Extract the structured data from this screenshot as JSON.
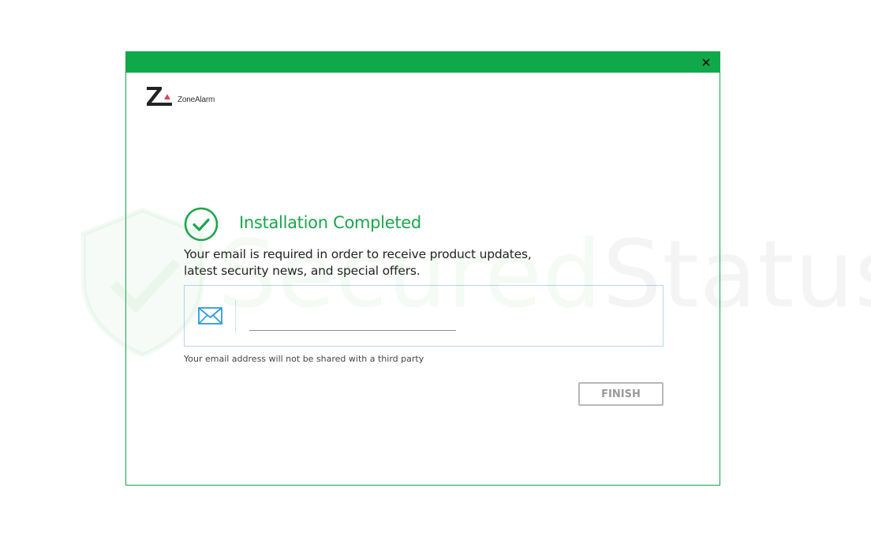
{
  "window": {
    "close_label": "×"
  },
  "logo": {
    "brand_name": "ZoneAlarm",
    "icon": "zonealarm-logo-icon"
  },
  "status": {
    "icon": "check-circle-icon",
    "heading": "Installation Completed",
    "message": "Your email is required in order to receive product updates, latest security news, and special offers."
  },
  "email": {
    "icon": "envelope-icon",
    "value": "",
    "placeholder": "",
    "note": "Your email address will not be shared with a third party"
  },
  "actions": {
    "finish_label": "FINISH"
  },
  "watermark": {
    "text_part1": "Secured",
    "text_part2": "Status"
  },
  "colors": {
    "accent": "#0fa94a",
    "heading": "#1aa64b",
    "mail_icon": "#2b9be0",
    "button_border": "#b8b8b8",
    "logo_red": "#d9445e"
  }
}
